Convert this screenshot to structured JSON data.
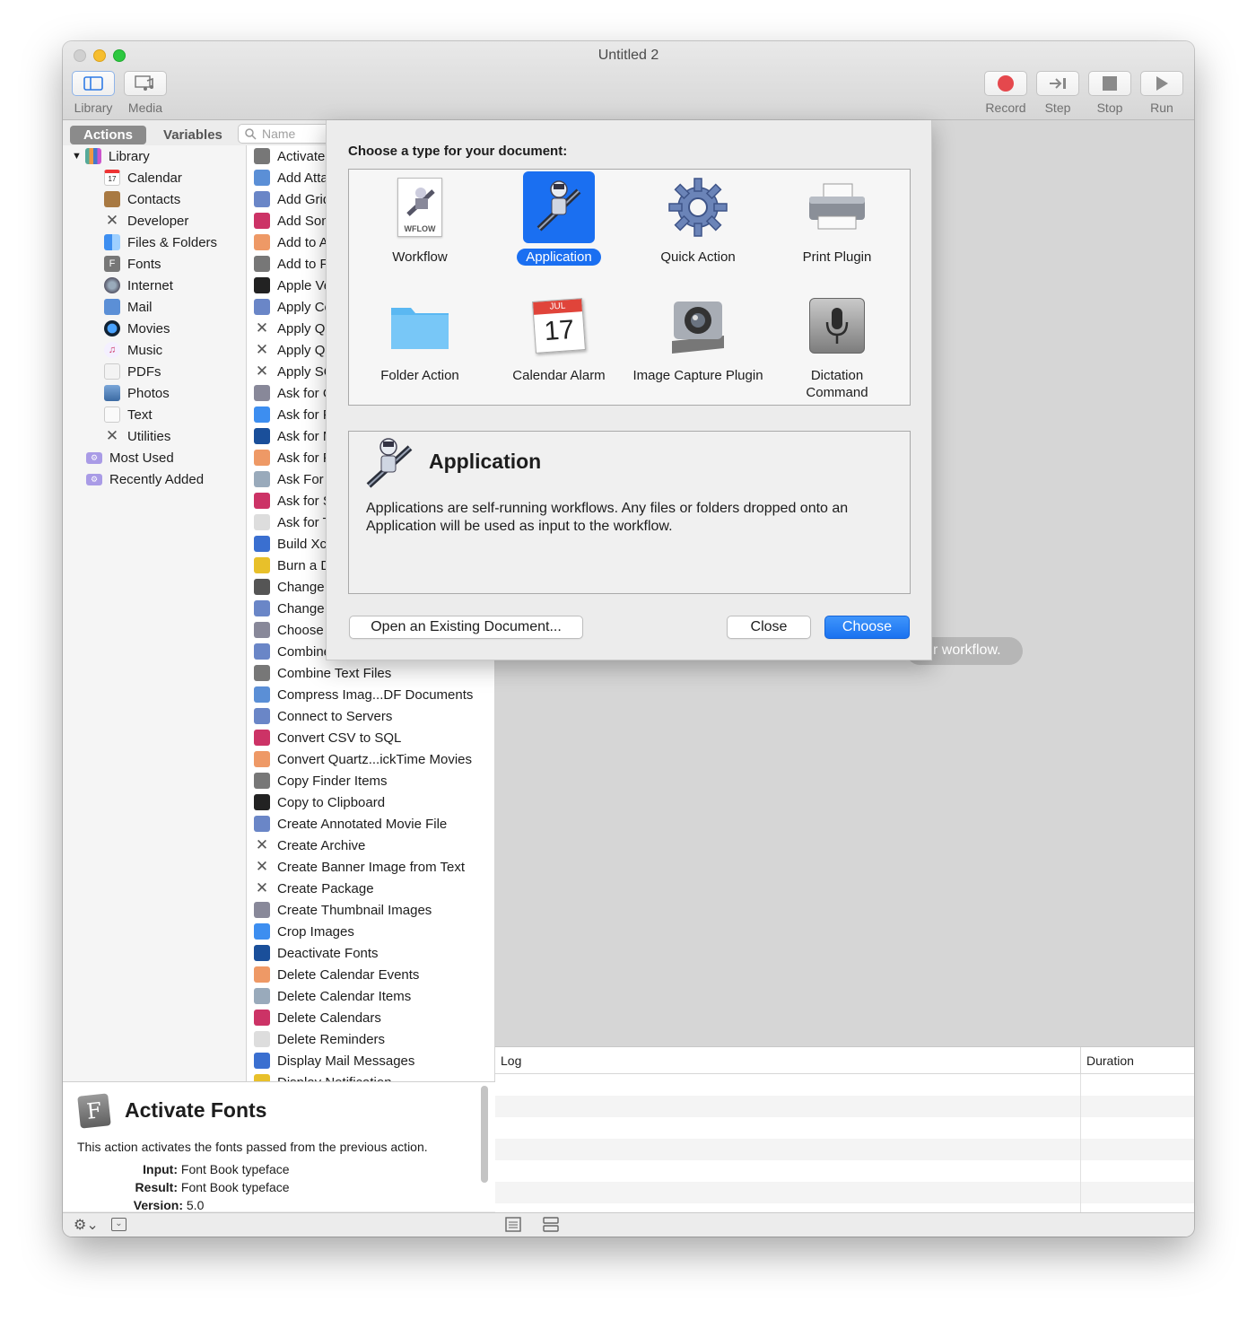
{
  "window": {
    "title": "Untitled 2"
  },
  "toolbar": {
    "library_label": "Library",
    "media_label": "Media",
    "record_label": "Record",
    "step_label": "Step",
    "stop_label": "Stop",
    "run_label": "Run"
  },
  "tabs": {
    "actions": "Actions",
    "variables": "Variables"
  },
  "search": {
    "placeholder": "Name"
  },
  "library": {
    "root": "Library",
    "items": [
      "Calendar",
      "Contacts",
      "Developer",
      "Files & Folders",
      "Fonts",
      "Internet",
      "Mail",
      "Movies",
      "Music",
      "PDFs",
      "Photos",
      "Text",
      "Utilities"
    ],
    "extras": [
      "Most Used",
      "Recently Added"
    ]
  },
  "actions_list": [
    "Activate Fonts",
    "Add Attachments",
    "Add Grid",
    "Add Songs",
    "Add to Album",
    "Add to Font Library",
    "Apple Versioning Tool",
    "Apply ColorSync Profile",
    "Apply Quartz Composition",
    "Apply Quartz Filter",
    "Apply SQL",
    "Ask for Confirmation",
    "Ask for Finder Items",
    "Ask for Movies",
    "Ask for Photos",
    "Ask For Servers",
    "Ask for Songs",
    "Ask for Text",
    "Build Xcode Project",
    "Burn a Disc",
    "Change System Appearance",
    "Change Type of Images",
    "Choose from List",
    "Combine PDF Pages",
    "Combine Text Files",
    "Compress Imag...DF Documents",
    "Connect to Servers",
    "Convert CSV to SQL",
    "Convert Quartz...ickTime Movies",
    "Copy Finder Items",
    "Copy to Clipboard",
    "Create Annotated Movie File",
    "Create Archive",
    "Create Banner Image from Text",
    "Create Package",
    "Create Thumbnail Images",
    "Crop Images",
    "Deactivate Fonts",
    "Delete Calendar Events",
    "Delete Calendar Items",
    "Delete Calendars",
    "Delete Reminders",
    "Display Mail Messages",
    "Display Notification"
  ],
  "description": {
    "title": "Activate Fonts",
    "text": "This action activates the fonts passed from the previous action.",
    "input_label": "Input:",
    "input_value": "Font Book typeface",
    "result_label": "Result:",
    "result_value": "Font Book typeface",
    "version_label": "Version:",
    "version_value": "5.0"
  },
  "canvas": {
    "hint": "r workflow."
  },
  "log": {
    "col_log": "Log",
    "col_duration": "Duration"
  },
  "sheet": {
    "prompt": "Choose a type for your document:",
    "types": [
      {
        "label": "Workflow",
        "icon": "wflow-document-icon"
      },
      {
        "label": "Application",
        "icon": "automator-robot-icon",
        "selected": true
      },
      {
        "label": "Quick Action",
        "icon": "gear-icon"
      },
      {
        "label": "Print Plugin",
        "icon": "printer-icon"
      },
      {
        "label": "Folder Action",
        "icon": "folder-icon"
      },
      {
        "label": "Calendar Alarm",
        "icon": "calendar-icon"
      },
      {
        "label": "Image Capture Plugin",
        "icon": "camera-icon"
      },
      {
        "label": "Dictation Command",
        "icon": "microphone-icon"
      }
    ],
    "calendar_month": "JUL",
    "calendar_day": "17",
    "wflow_badge": "WFLOW",
    "info_title": "Application",
    "info_text": "Applications are self-running workflows. Any files or folders dropped onto an Application will be used as input to the workflow.",
    "open_existing": "Open an Existing Document...",
    "close": "Close",
    "choose": "Choose"
  },
  "colors": {
    "accent": "#1a6ff1",
    "record": "#e5484d"
  }
}
